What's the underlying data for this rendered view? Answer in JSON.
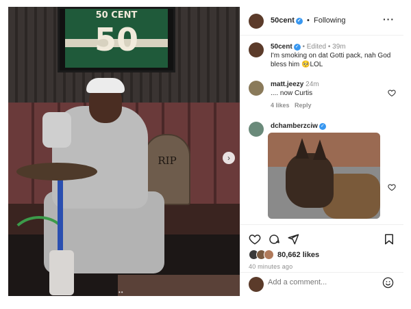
{
  "post_image": {
    "jersey_name": "50 CENT",
    "jersey_number": "50",
    "tombstone_text": "RIP",
    "next_icon": "chevron-right-icon",
    "carousel_dots": "••"
  },
  "header": {
    "username": "50cent",
    "verified": true,
    "separator": "•",
    "follow_status": "Following",
    "more_icon": "more-horizontal-icon",
    "more_label": "…"
  },
  "caption": {
    "username": "50cent",
    "edited": "• Edited •",
    "time": "39m",
    "line1": "I'm smoking on dat Gotti pack, nah God",
    "line2": "bless him 🥺LOL"
  },
  "comments": [
    {
      "username": "matt.jeezy",
      "time": "24m",
      "text": ".... now Curtis",
      "likes": "4 likes",
      "reply": "Reply"
    },
    {
      "username": "dchamberzciw",
      "verified": true
    }
  ],
  "actions": {
    "likes_count": "80,662 likes",
    "posted_ago": "40 minutes ago"
  },
  "add_comment": {
    "placeholder": "Add a comment...",
    "emoji_icon": "smiley-icon"
  },
  "colors": {
    "verified_blue": "#3897f0",
    "muted_text": "#8e8e8e",
    "primary_text": "#262626"
  }
}
